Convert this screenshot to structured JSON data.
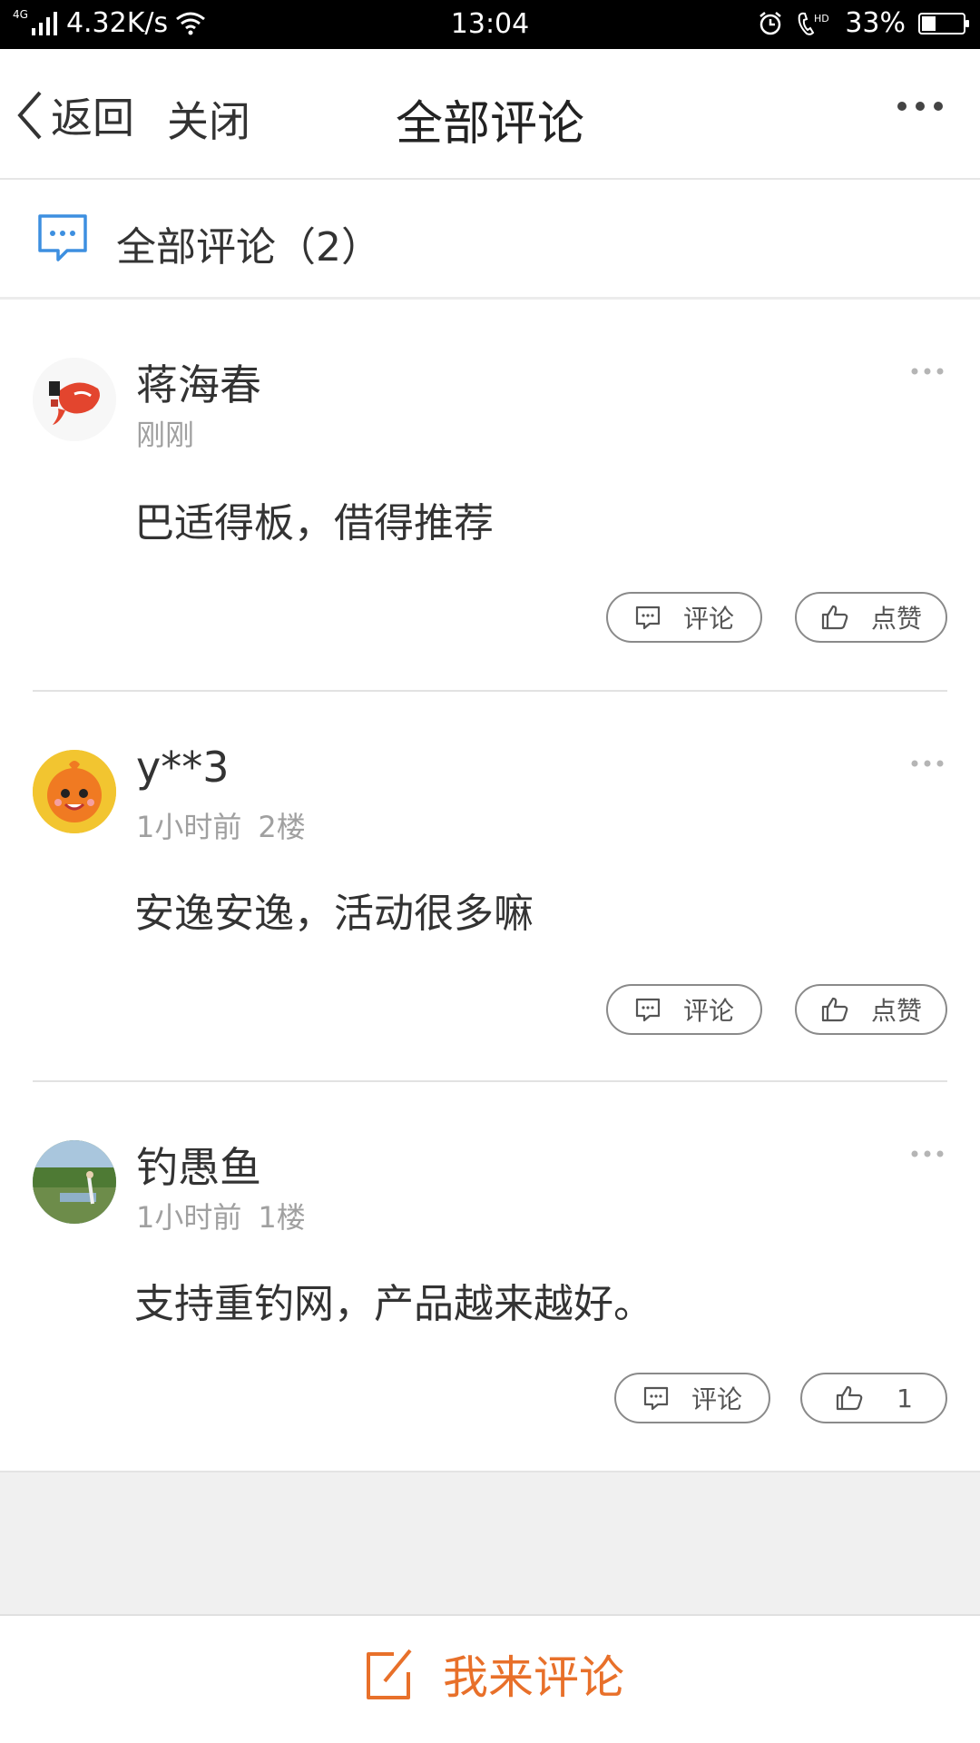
{
  "status_bar": {
    "network_tag": "4G",
    "speed": "4.32K/s",
    "time": "13:04",
    "battery": "33%",
    "battery_level": 0.33,
    "icons": [
      "signal-icon",
      "wifi-icon",
      "alarm-icon",
      "hd-call-icon",
      "battery-icon"
    ]
  },
  "nav": {
    "back_label": "返回",
    "close_label": "关闭",
    "title": "全部评论"
  },
  "header": {
    "title": "全部评论（2）"
  },
  "comments": [
    {
      "name": "蒋海春",
      "time": "刚刚",
      "floor": "",
      "text": "巴适得板，借得推荐",
      "reply_label": "评论",
      "like_label": "点赞"
    },
    {
      "name": "y**3",
      "time": "1小时前",
      "floor": "2楼",
      "text": "安逸安逸，活动很多嘛",
      "reply_label": "评论",
      "like_label": "点赞"
    },
    {
      "name": "钓愚鱼",
      "time": "1小时前",
      "floor": "1楼",
      "text": "支持重钓网，产品越来越好。",
      "reply_label": "评论",
      "like_label": "1"
    }
  ],
  "bottom": {
    "write_label": "我来评论"
  },
  "colors": {
    "accent": "#e8702a",
    "header_icon": "#3d8fe0"
  }
}
